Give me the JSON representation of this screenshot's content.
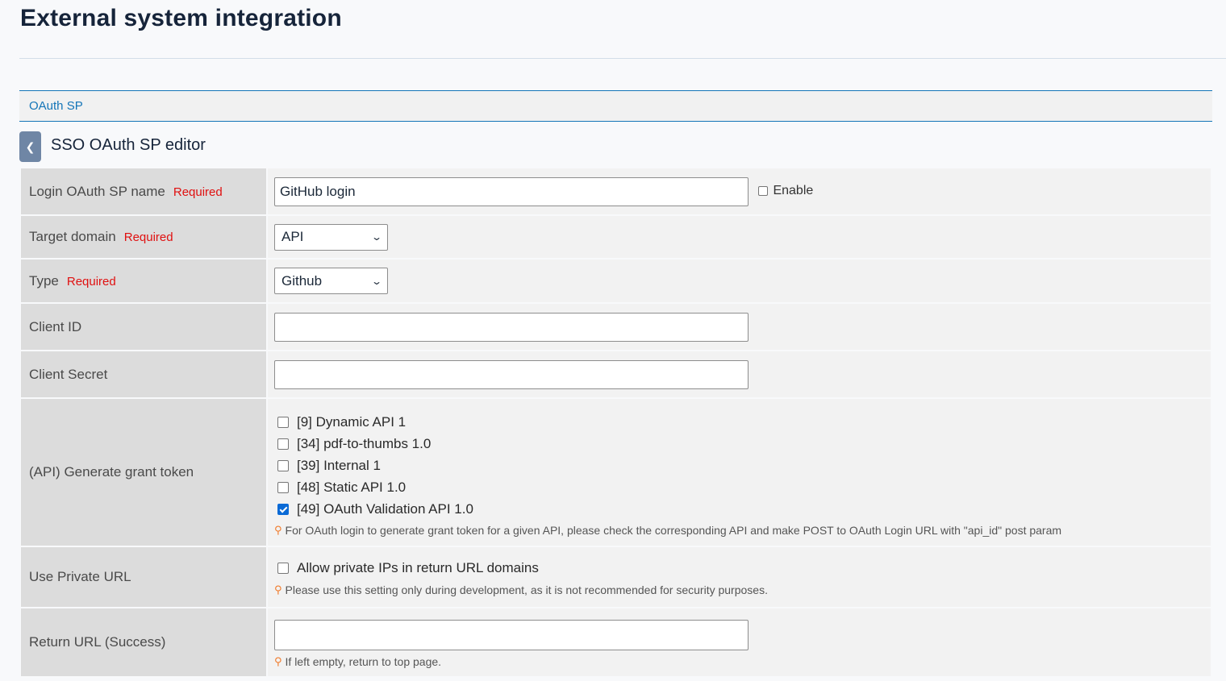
{
  "page": {
    "title": "External system integration",
    "section": "OAuth SP",
    "editor_title": "SSO OAuth SP editor",
    "back_icon": "chevron-left-icon"
  },
  "form": {
    "required_label": "Required",
    "sp_name": {
      "label": "Login OAuth SP name",
      "value": "GitHub login",
      "enable_label": "Enable",
      "enable_checked": false
    },
    "target_domain": {
      "label": "Target domain",
      "selected": "API"
    },
    "type": {
      "label": "Type",
      "selected": "Github"
    },
    "client_id": {
      "label": "Client ID",
      "value": ""
    },
    "client_secret": {
      "label": "Client Secret",
      "value": ""
    },
    "grant_token": {
      "label": "(API) Generate grant token",
      "apis": [
        {
          "label": "[9] Dynamic API 1",
          "checked": false
        },
        {
          "label": "[34] pdf-to-thumbs 1.0",
          "checked": false
        },
        {
          "label": "[39] Internal 1",
          "checked": false
        },
        {
          "label": "[48] Static API 1.0",
          "checked": false
        },
        {
          "label": "[49] OAuth Validation API 1.0",
          "checked": true
        }
      ],
      "hint": "For OAuth login to generate grant token for a given API, please check the corresponding API and make POST to OAuth Login URL with \"api_id\" post param"
    },
    "private_url": {
      "label": "Use Private URL",
      "checkbox_label": "Allow private IPs in return URL domains",
      "checked": false,
      "hint": "Please use this setting only during development, as it is not recommended for security purposes."
    },
    "return_url": {
      "label": "Return URL (Success)",
      "value": "",
      "hint": "If left empty, return to top page."
    }
  }
}
